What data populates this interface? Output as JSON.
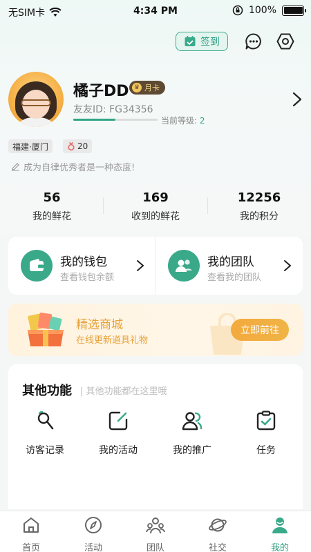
{
  "status_bar": {
    "carrier": "无SIM卡",
    "time": "4:34 PM",
    "battery": "100%"
  },
  "header": {
    "signin_label": "签到"
  },
  "profile": {
    "nickname": "橘子DD",
    "vip_label": "月卡",
    "uid": "友友ID: FG34356",
    "level_label": "当前等级:",
    "level_value": "2",
    "level_progress": 0.5,
    "location_tag": "福建·厦门",
    "gender_age": "20",
    "motto": "成为自律优秀者是一种态度!"
  },
  "stats": [
    {
      "value": "56",
      "label": "我的鲜花"
    },
    {
      "value": "169",
      "label": "收到的鲜花"
    },
    {
      "value": "12256",
      "label": "我的积分"
    }
  ],
  "cards": {
    "wallet": {
      "title": "我的钱包",
      "subtitle": "查看钱包余额"
    },
    "team": {
      "title": "我的团队",
      "subtitle": "查看我的团队"
    }
  },
  "mall": {
    "title": "精选商城",
    "subtitle": "在线更新道具礼物",
    "button": "立即前往"
  },
  "functions": {
    "title": "其他功能",
    "subtitle": "| 其他功能都在这里哦",
    "items": [
      {
        "label": "访客记录",
        "icon": "magnifier-icon"
      },
      {
        "label": "我的活动",
        "icon": "edit-square-icon"
      },
      {
        "label": "我的推广",
        "icon": "users-icon"
      },
      {
        "label": "任务",
        "icon": "clipboard-check-icon"
      }
    ]
  },
  "tabs": [
    {
      "label": "首页",
      "icon": "home-icon"
    },
    {
      "label": "活动",
      "icon": "compass-icon"
    },
    {
      "label": "团队",
      "icon": "team-icon"
    },
    {
      "label": "社交",
      "icon": "planet-icon"
    },
    {
      "label": "我的",
      "icon": "profile-icon",
      "active": true
    }
  ],
  "colors": {
    "accent": "#2f9f82",
    "mall_accent": "#e7a23a",
    "vip_bg": "#5e4a32"
  }
}
